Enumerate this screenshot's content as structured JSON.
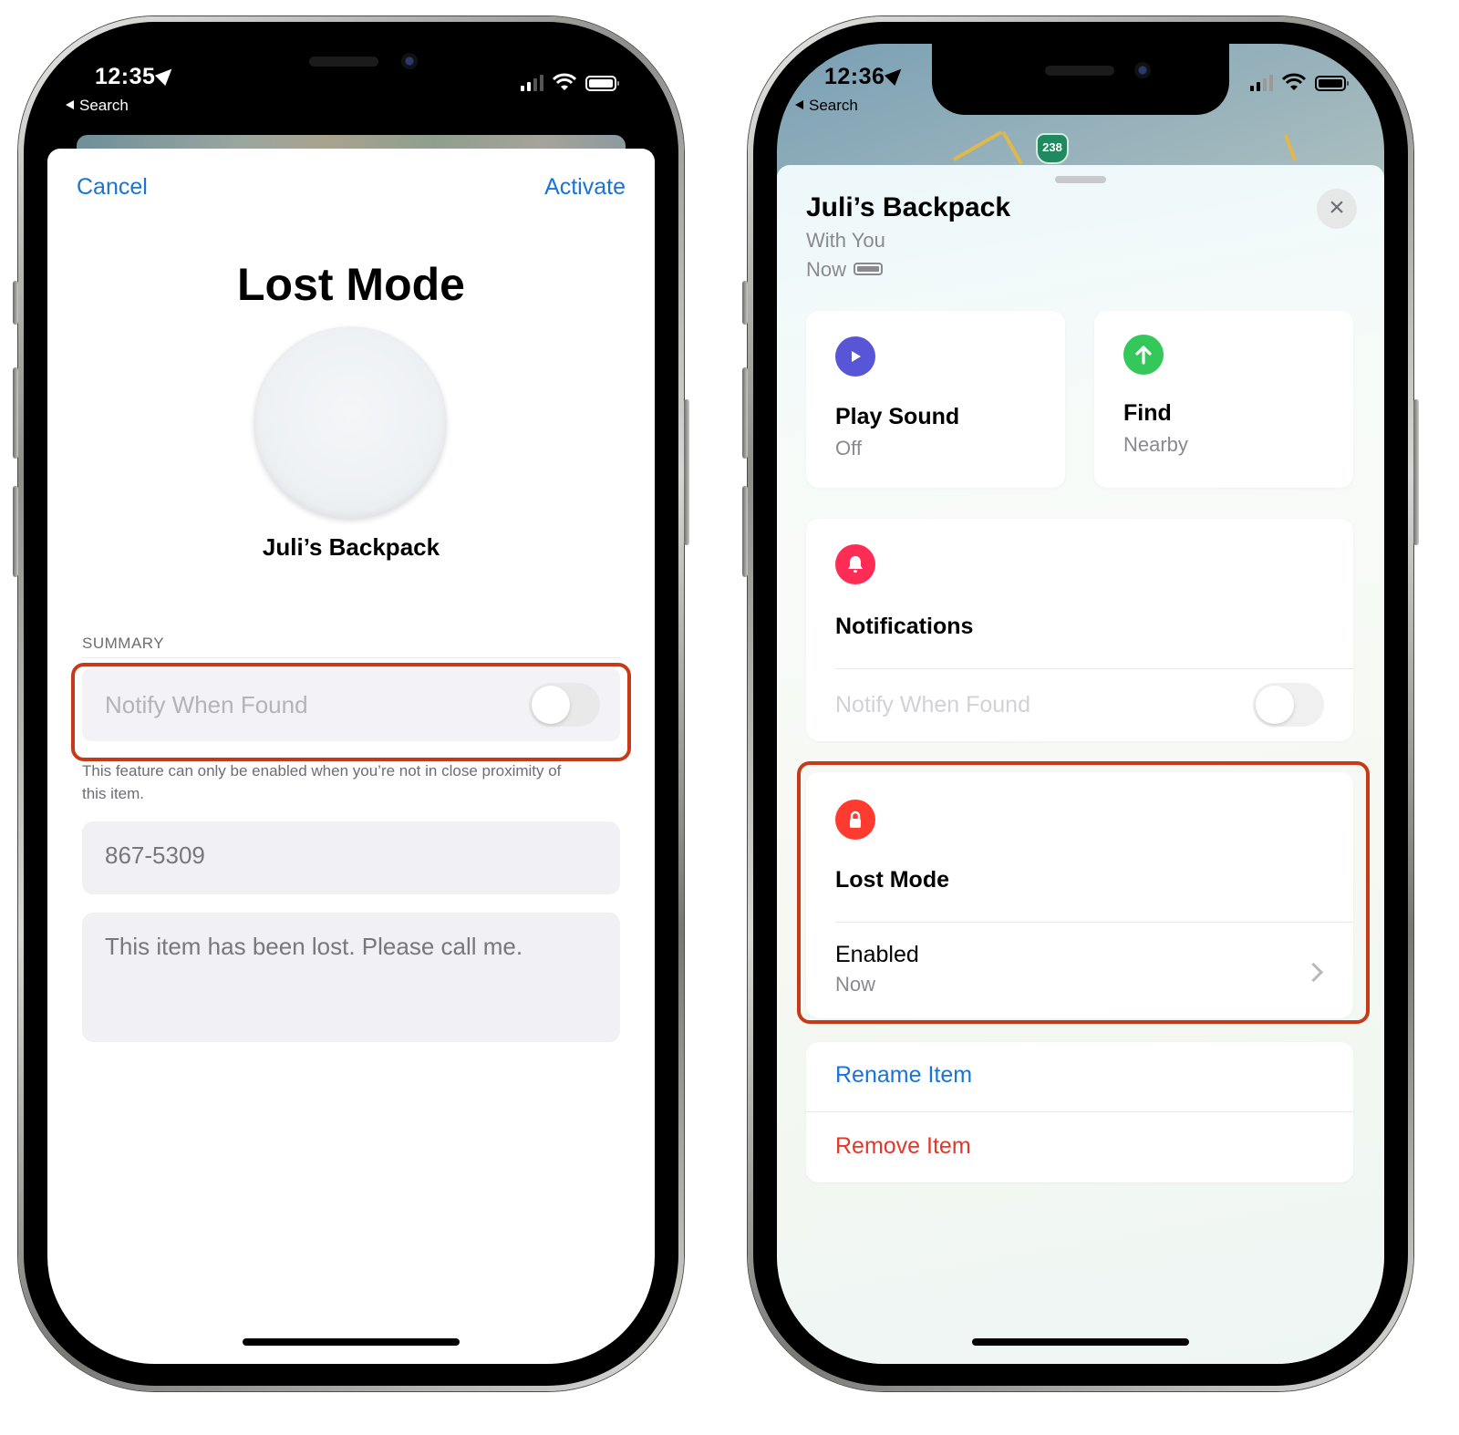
{
  "left_phone": {
    "status_bar": {
      "time": "12:35",
      "back_label": "Search"
    },
    "nav": {
      "cancel": "Cancel",
      "activate": "Activate"
    },
    "title": "Lost Mode",
    "item_name": "Juli’s Backpack",
    "summary_header": "SUMMARY",
    "notify_when_found": {
      "label": "Notify When Found",
      "enabled": false
    },
    "notify_note": "This feature can only be enabled when you’re not in close proximity of this item.",
    "phone_field": {
      "value": "867-5309"
    },
    "message_field": {
      "value": "This item has been lost. Please call me."
    }
  },
  "right_phone": {
    "status_bar": {
      "time": "12:36",
      "back_label": "Search"
    },
    "map": {
      "route_shield": "238"
    },
    "header": {
      "title": "Juli’s Backpack",
      "location": "With You",
      "updated": "Now"
    },
    "close_icon": "×",
    "tiles": [
      {
        "title": "Play Sound",
        "subtitle": "Off",
        "icon": "play-icon",
        "color": "#5856d6"
      },
      {
        "title": "Find",
        "subtitle": "Nearby",
        "icon": "arrow-up-icon",
        "color": "#34c759"
      }
    ],
    "notifications": {
      "title": "Notifications",
      "icon": "bell-icon",
      "color": "#ff2d55",
      "toggle_label": "Notify When Found",
      "enabled": false
    },
    "lost_mode": {
      "title": "Lost Mode",
      "icon": "lock-icon",
      "color": "#ff3b30",
      "status": "Enabled",
      "status_time": "Now"
    },
    "actions": {
      "rename": "Rename Item",
      "remove": "Remove Item"
    }
  },
  "colors": {
    "ios_blue": "#1a73d6",
    "ios_red": "#e0392b",
    "highlight": "#c63a1a"
  }
}
